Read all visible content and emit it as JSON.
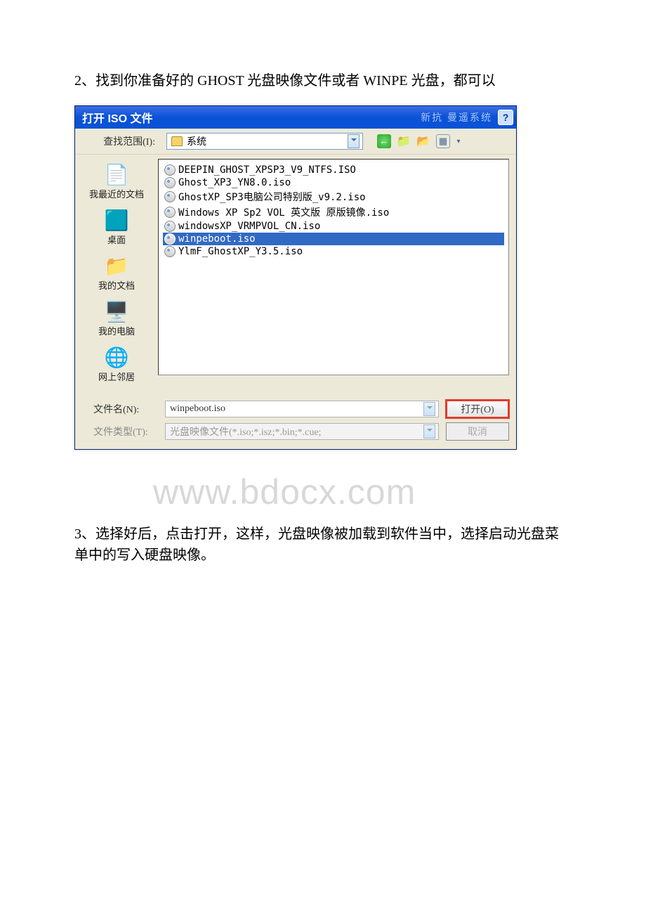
{
  "instruction_2": "2、找到你准备好的 GHOST 光盘映像文件或者 WINPE 光盘，都可以",
  "dialog": {
    "title": "打开 ISO 文件",
    "decor_text": "新抗 曼遥系统",
    "help_symbol": "?",
    "lookin_label": "查找范围(I):",
    "lookin_value": "系统",
    "places": {
      "recent": "我最近的文档",
      "desktop": "桌面",
      "docs": "我的文档",
      "computer": "我的电脑",
      "network": "网上邻居"
    },
    "files": [
      "DEEPIN_GHOST_XPSP3_V9_NTFS.ISO",
      "Ghost_XP3_YN8.0.iso",
      "GhostXP_SP3电脑公司特别版_v9.2.iso",
      "Windows XP Sp2 VOL 英文版 原版镜像.iso",
      "windowsXP_VRMPVOL_CN.iso",
      "winpeboot.iso",
      "YlmF_GhostXP_Y3.5.iso"
    ],
    "selected_index": 5,
    "filename_label": "文件名(N):",
    "filename_value": "winpeboot.iso",
    "filetype_label": "文件类型(T):",
    "filetype_value": "光盘映像文件(*.iso;*.isz;*.bin;*.cue;",
    "open_btn": "打开(O)",
    "cancel_btn": "取消"
  },
  "watermark": "www.bdocx.com",
  "instruction_3": "3、选择好后，点击打开，这样，光盘映像被加载到软件当中，选择启动光盘菜单中的写入硬盘映像。"
}
